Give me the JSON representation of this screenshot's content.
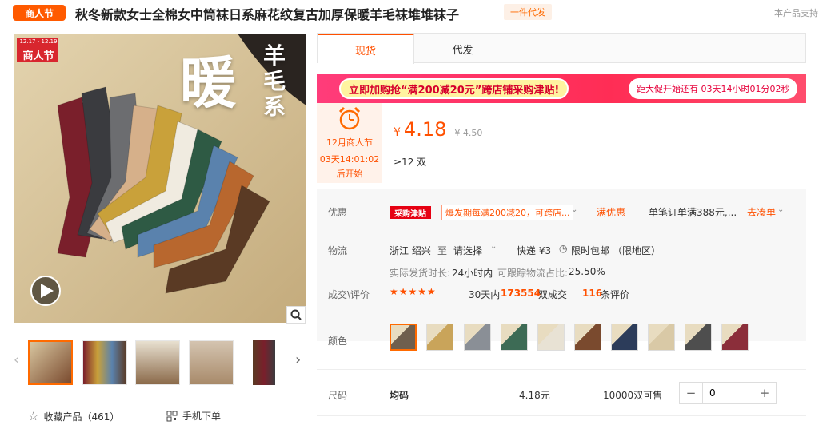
{
  "header": {
    "badge": "商人节",
    "title": "秋冬新款女士全棉女中筒袜日系麻花纹复古加厚保暖羊毛袜堆堆袜子",
    "dropship_badge": "一件代发",
    "right_note": "本产品支持"
  },
  "gallery": {
    "overlay_dates": "12.17 - 12.19",
    "overlay_badge": "商人节",
    "big_char": "暖",
    "side_text": "羊毛系",
    "favorite_label": "收藏产品（461）",
    "mobile_label": "手机下单"
  },
  "tabs": [
    {
      "label": "现货",
      "active": true
    },
    {
      "label": "代发",
      "active": false
    }
  ],
  "promo": {
    "main": "立即加购抢“满200减20元”跨店铺采购津贴!",
    "countdown": "距大促开始还有 03天14小时01分02秒"
  },
  "festival": {
    "line1": "12月商人节",
    "line2": "03天14:01:02",
    "line3": "后开始"
  },
  "price": {
    "currency": "¥",
    "value": "4.18",
    "original": "¥ 4.50",
    "moq": "≥12 双"
  },
  "discount": {
    "label": "优惠",
    "tag": "采购津贴",
    "desc": "爆发期每满200减20，可跨店...",
    "full_reduction": "满优惠",
    "full_desc": "单笔订单满388元,...",
    "collect_link": "去凑单"
  },
  "logistics": {
    "label": "物流",
    "origin": "浙江 绍兴",
    "to": "至",
    "destination": "请选择",
    "shipping": "快递 ¥3",
    "free_ship": "限时包邮",
    "region_limit": "（限地区）",
    "ship_time_label": "实际发货时长:",
    "ship_time": "24小时内",
    "traceable_label": "可跟踪物流占比:",
    "traceable": "25.50%"
  },
  "deals": {
    "label": "成交\\评价",
    "stars": "★★★★★",
    "recent_prefix": "30天内",
    "recent_count": "173554",
    "recent_suffix": "双成交",
    "reviews_count": "116",
    "reviews_suffix": "条评价"
  },
  "color": {
    "label": "颜色",
    "swatches": [
      "#6f5f4e",
      "#c9a45a",
      "#8a8f96",
      "#3d6b55",
      "#e8e2d4",
      "#7a4a2e",
      "#2c3c5a",
      "#d9c9a6",
      "#4e4e4e",
      "#8b2e3a"
    ]
  },
  "size": {
    "label": "尺码",
    "name": "均码",
    "price": "4.18元",
    "stock": "10000双可售",
    "qty": "0",
    "minus": "−",
    "plus": "+"
  }
}
